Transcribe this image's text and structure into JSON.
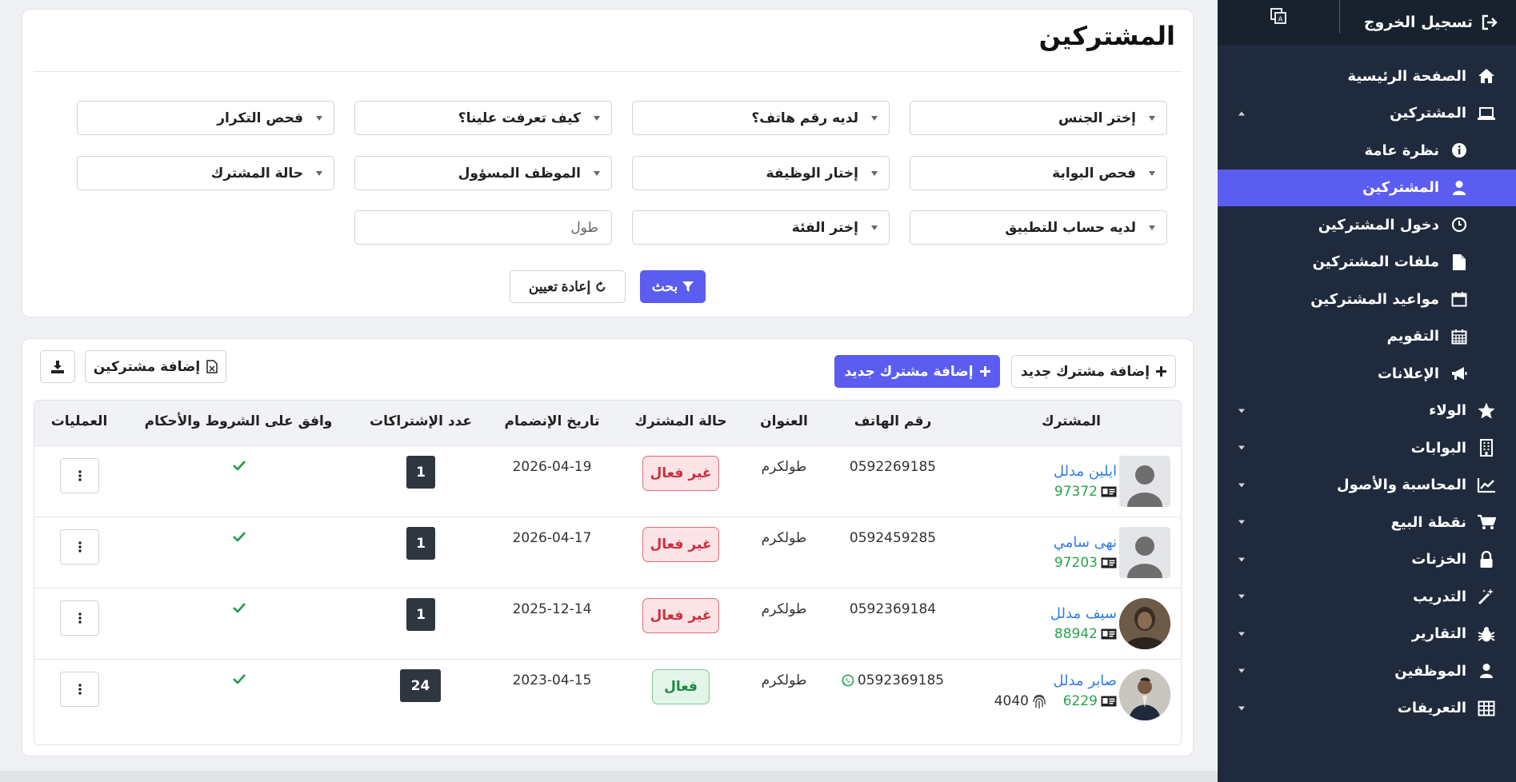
{
  "sidebar": {
    "logout_label": "تسجيل الخروج",
    "items": [
      {
        "label": "الصفحة الرئيسية",
        "icon": "home-icon"
      },
      {
        "label": "المشتركين",
        "icon": "laptop-icon",
        "expanded": true
      },
      {
        "label": "نظرة عامة",
        "icon": "info-icon"
      },
      {
        "label": "المشتركين",
        "icon": "user-icon",
        "active": true
      },
      {
        "label": "دخول المشتركين",
        "icon": "clock-icon"
      },
      {
        "label": "ملفات المشتركين",
        "icon": "file-icon"
      },
      {
        "label": "مواعيد المشتركين",
        "icon": "calendar-icon"
      },
      {
        "label": "التقويم",
        "icon": "calendar-grid-icon"
      },
      {
        "label": "الإعلانات",
        "icon": "megaphone-icon"
      },
      {
        "label": "الولاء",
        "icon": "star-icon"
      },
      {
        "label": "البوابات",
        "icon": "building-icon"
      },
      {
        "label": "المحاسبة والأصول",
        "icon": "chart-icon"
      },
      {
        "label": "نقطة البيع",
        "icon": "cart-icon"
      },
      {
        "label": "الخزنات",
        "icon": "lock-icon"
      },
      {
        "label": "التدريب",
        "icon": "wand-icon"
      },
      {
        "label": "التقارير",
        "icon": "bug-icon"
      },
      {
        "label": "الموظفين",
        "icon": "user-icon"
      },
      {
        "label": "التعريفات",
        "icon": "table-icon"
      }
    ]
  },
  "page": {
    "title": "المشتركين"
  },
  "filters": {
    "gender": "إختر الجنس",
    "has_phone": "لديه رقم هاتف؟",
    "how_found": "كيف تعرفت علينا؟",
    "duplicate_check": "فحص التكرار",
    "gate_check": "فحص البوابة",
    "job": "إختار الوظيفة",
    "responsible_employee": "الموظف المسؤول",
    "subscriber_status": "حالة المشترك",
    "has_app_account": "لديه حساب للتطبيق",
    "category": "إختر الفئة",
    "city_value": "طول",
    "search_label": "بحث",
    "reset_label": "إعادة تعيين"
  },
  "toolbar": {
    "add_new_outline": "إضافة مشترك جديد",
    "add_new_primary": "إضافة مشترك جديد",
    "import_label": "إضافة مشتركين"
  },
  "table": {
    "headers": {
      "subscriber": "المشترك",
      "phone": "رقم الهاتف",
      "address": "العنوان",
      "status": "حالة المشترك",
      "joined": "تاريخ الإنضمام",
      "subs_count": "عدد الإشتراكات",
      "terms": "وافق على الشروط والأحكام",
      "ops": "العمليات"
    },
    "rows": [
      {
        "name": "ايلين مدلل",
        "id": "97372",
        "phone": "0592269185",
        "address": "طولكرم",
        "status": "غير فعال",
        "active": false,
        "joined": "2026-04-19",
        "count": "1"
      },
      {
        "name": "نهى سامي",
        "id": "97203",
        "phone": "0592459285",
        "address": "طولكرم",
        "status": "غير فعال",
        "active": false,
        "joined": "2026-04-17",
        "count": "1"
      },
      {
        "name": "سيف مدلل",
        "id": "88942",
        "phone": "0592369184",
        "address": "طولكرم",
        "status": "غير فعال",
        "active": false,
        "joined": "2025-12-14",
        "count": "1"
      },
      {
        "name": "صابر مدلل",
        "id": "6229",
        "fingerprint": "4040",
        "phone": "0592369185",
        "address": "طولكرم",
        "status": "فعال",
        "active": true,
        "joined": "2023-04-15",
        "count": "24"
      }
    ]
  },
  "colors": {
    "accent": "#5b5cf0",
    "sidebar_bg": "#1f2b3c",
    "link": "#2f7ce6",
    "id_green": "#2aa34a"
  }
}
